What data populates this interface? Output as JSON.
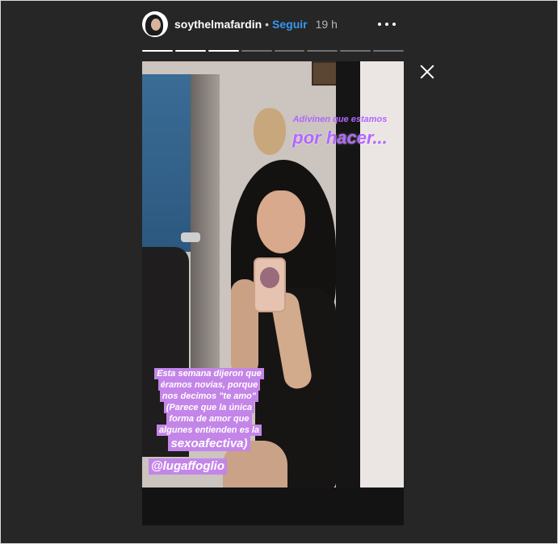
{
  "header": {
    "username": "soythelmafardin",
    "separator": "•",
    "follow_label": "Seguir",
    "time_ago": "19 h",
    "avatar": "avatar-photo",
    "more_icon": "more-options-icon"
  },
  "progress": {
    "total_segments": 8,
    "completed_segments": 3
  },
  "close_icon": "close-icon",
  "story": {
    "caption_top_small": "Adivinen que estamos",
    "caption_top_large": "por hacer...",
    "caption_lines": [
      "Esta semana dijeron que",
      "éramos novias, porque",
      "nos decimos \"te amo\"",
      "(Parece que la única",
      "forma de amor que",
      "algunes entienden es la",
      "sexoafectiva)"
    ],
    "mention": "@lugaffoglio"
  },
  "colors": {
    "background": "#262626",
    "follow": "#3897f0",
    "highlight": "#c485e8",
    "caption_text": "#b266ff"
  }
}
